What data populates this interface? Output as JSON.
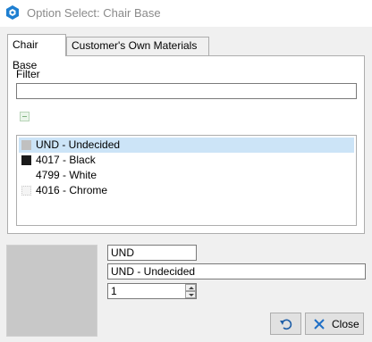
{
  "window": {
    "title": "Option Select: Chair Base"
  },
  "tabs": [
    {
      "label": "Chair Base",
      "active": true
    },
    {
      "label": "Customer's Own Materials",
      "active": false
    }
  ],
  "filter": {
    "label": "Filter",
    "value": ""
  },
  "options": [
    {
      "label": "UND - Undecided",
      "swatch": "#c0c0c0",
      "selected": true
    },
    {
      "label": "4017 - Black",
      "swatch": "#1a1a1a",
      "selected": false
    },
    {
      "label": "4799 - White",
      "swatch": "#ffffff",
      "selected": false
    },
    {
      "label": "4016 - Chrome",
      "swatch": "#f4f4f4",
      "selected": false
    }
  ],
  "selection": {
    "code": "UND",
    "name": "UND - Undecided",
    "quantity": "1",
    "preview_color": "#c8c8c8"
  },
  "buttons": {
    "undo_icon": "undo-icon",
    "close_label": "Close",
    "close_icon": "close-x-icon"
  },
  "colors": {
    "accent": "#0078d7",
    "selected_row": "#cce4f7"
  }
}
